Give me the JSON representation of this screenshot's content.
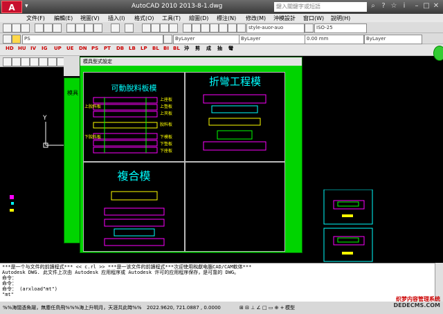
{
  "app": {
    "logo": "A",
    "title": "AutoCAD 2010    2013-8-1.dwg",
    "search_placeholder": "鍵入關鍵字或短語"
  },
  "menu": [
    "文件(F)",
    "編輯(E)",
    "視圖(V)",
    "插入(I)",
    "格式(O)",
    "工具(T)",
    "繪圖(D)",
    "標注(N)",
    "修改(M)",
    "沖模設計",
    "窗口(W)",
    "說明(H)"
  ],
  "toolbar": {
    "text_style": "style-auor-auo",
    "dim_style": "ISO-25",
    "layer": "PS",
    "color": "ByLayer",
    "linetype": "ByLayer",
    "lineweight": "0.00 mm",
    "plotstyle": "ByLayer"
  },
  "red_toolbar": [
    "HD",
    "HU",
    "IV",
    "IG",
    "UP",
    "UE",
    "DN",
    "PS",
    "PT",
    "DB",
    "LB",
    "LP",
    "BL",
    "BI",
    "BL",
    "沖",
    "剪",
    "成",
    "抽",
    "彎"
  ],
  "dialog": {
    "title": "模具型式設定",
    "panels": [
      {
        "title": "可動脫料板模",
        "labels": [
          "上座板",
          "上墊板",
          "上夾板",
          "脫料板",
          "下模板",
          "下墊板",
          "下座板",
          "上脫料板",
          "下脫料板"
        ]
      },
      {
        "title": "折彎工程模"
      },
      {
        "title": "複合模"
      },
      {
        "title": ""
      }
    ]
  },
  "ghost_dialog_label": "模具",
  "ucs_label": "Y",
  "command_lines": [
    "***是一个与文件的前讀程式*** << c.rl >> ***是一该文件的前讀程式***次迎使用稅獻电腦CAD/CAM軟体***",
    "Autodesk DWG.   此文件上次由 Autodesk 应用程序或 Autodesk 许可的应用程序保存，是可靠的 DWG。",
    "命令：",
    "命令：",
    "命令： (arxload\"mt\")",
    "\"mt\""
  ],
  "status": {
    "marquee": "%%海闊憑魚躍，無塵任鳥飛%%%海上升明月，天涯共此時%%",
    "coords": "2022.9620, 721.0887 , 0.0000",
    "mode": "模型"
  },
  "watermark": {
    "line1": "织梦内容管理系统",
    "line2": "DEDECMS.COM"
  },
  "colors": {
    "dialog_bg": "#00d400",
    "canvas": "#000000",
    "cyan_text": "#00ffff"
  }
}
